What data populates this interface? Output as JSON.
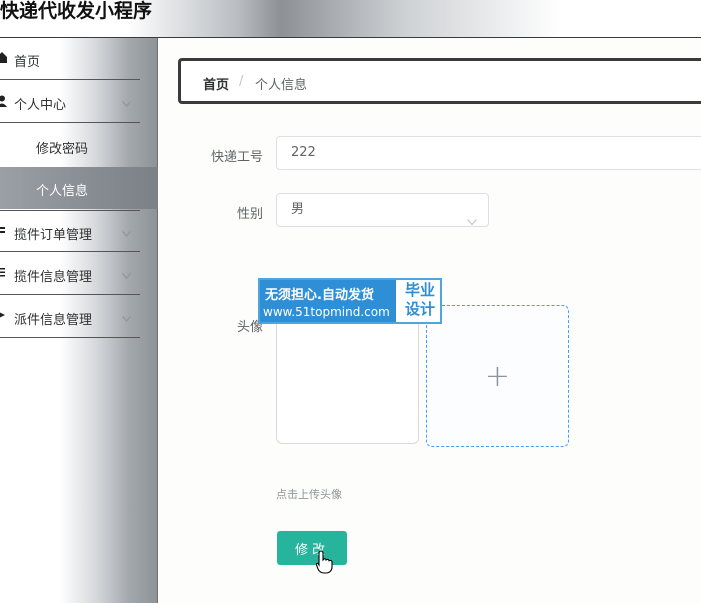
{
  "app": {
    "title": "快递代收发小程序"
  },
  "sidebar": {
    "items": [
      {
        "label": "首页",
        "icon": "home-icon"
      },
      {
        "label": "个人中心",
        "icon": "user-icon",
        "expanded": true
      },
      {
        "label": "修改密码"
      },
      {
        "label": "个人信息",
        "active": true
      },
      {
        "label": "揽件订单管理",
        "icon": "menu-icon"
      },
      {
        "label": "揽件信息管理",
        "icon": "list-icon"
      },
      {
        "label": "派件信息管理",
        "icon": "send-icon"
      }
    ]
  },
  "breadcrumb": {
    "home": "首页",
    "separator": "/",
    "current": "个人信息"
  },
  "form": {
    "courier_id": {
      "label": "快递工号",
      "value": "222"
    },
    "gender": {
      "label": "性别",
      "value": "男"
    },
    "avatar": {
      "label": "头像",
      "hint": "点击上传头像",
      "upload_symbol": "+"
    },
    "submit_label": "修改"
  },
  "watermark": {
    "line1": "无须担心.自动发货",
    "line2": "www.51topmind.com",
    "right_line1": "毕业",
    "right_line2": "设计"
  },
  "colors": {
    "accent": "#26b59c",
    "upload_border": "#409eff",
    "watermark": "#2f8fd6"
  }
}
